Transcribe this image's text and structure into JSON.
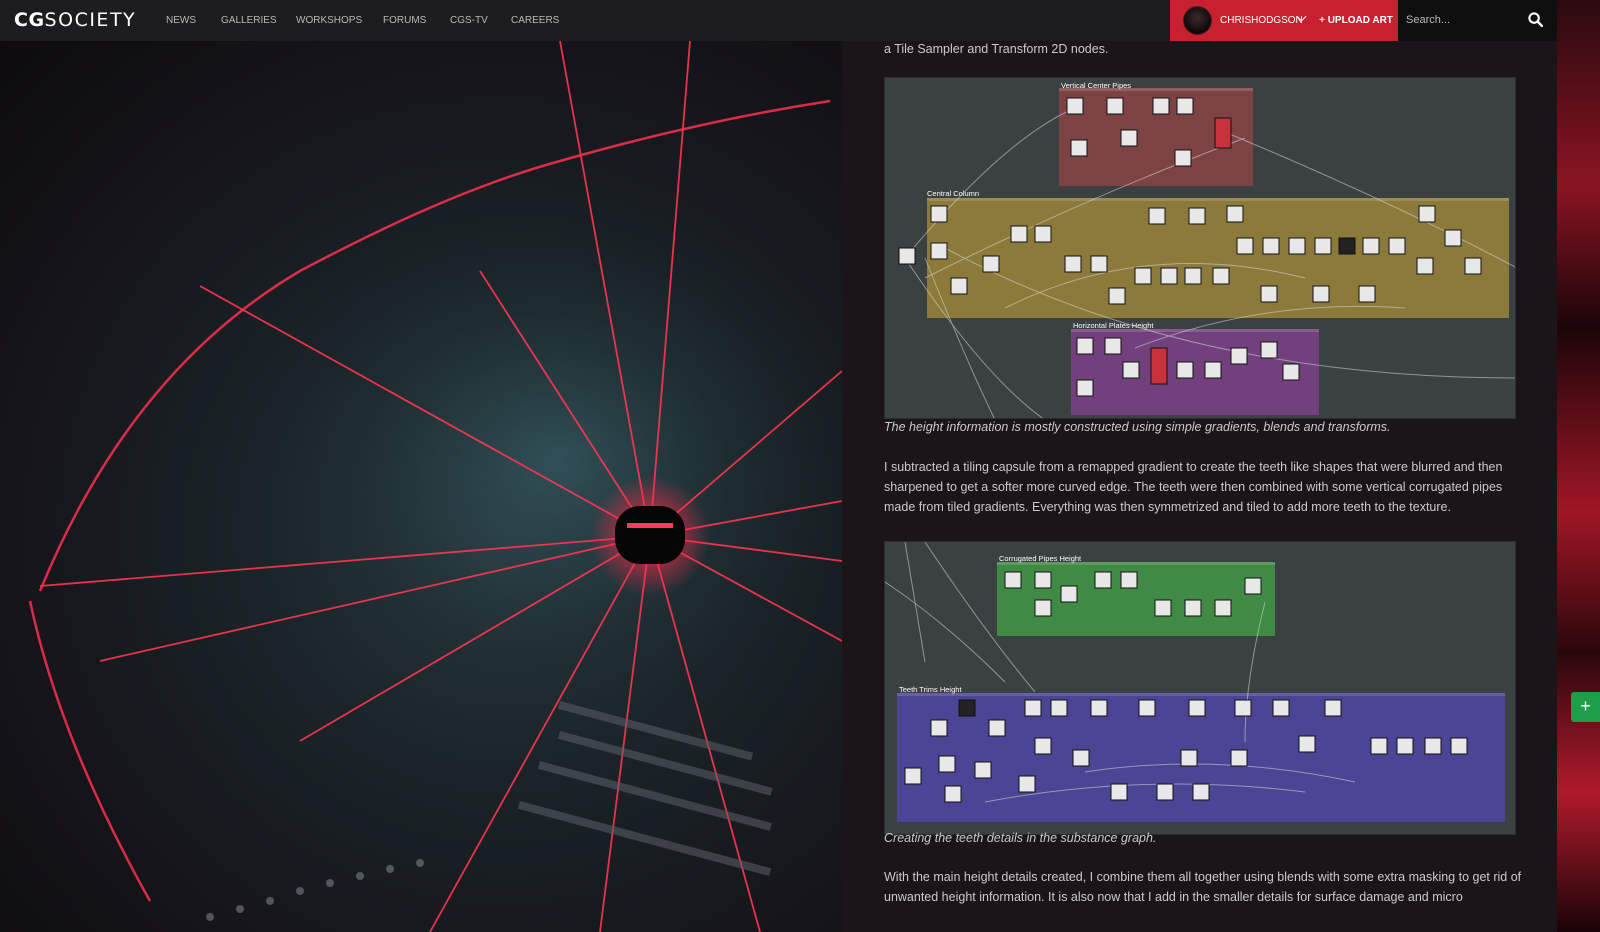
{
  "nav": {
    "logo_bold": "CG",
    "logo_light": "SOCIETY",
    "items": [
      "NEWS",
      "GALLERIES",
      "WORKSHOPS",
      "FORUMS",
      "CGS-TV",
      "CAREERS"
    ]
  },
  "user": {
    "name": "CHRISHODGSON",
    "upload_label": "+ UPLOAD ART"
  },
  "search": {
    "placeholder": "Search..."
  },
  "article": {
    "intro_fragment": "a Tile Sampler and Transform 2D nodes.",
    "graph1": {
      "groups": [
        "Vertical Center Pipes",
        "Central Column",
        "Horizontal Plates Height"
      ]
    },
    "caption1": "The height information is mostly constructed using simple gradients, blends and transforms.",
    "para2": "I subtracted a tiling capsule from a remapped gradient to create the teeth like shapes that were blurred and then sharpened to get a softer more curved edge. The teeth were then combined with some vertical corrugated pipes made from tiled gradients. Everything was then symmetrized and tiled to add more teeth to the texture.",
    "graph2": {
      "groups": [
        "Corrugated Pipes Height",
        "Teeth Trims Height"
      ]
    },
    "caption2": "Creating the teeth details in the substance graph.",
    "para3": "With the main height details created, I combine them all together using blends with some extra masking to get rid of unwanted height information. It is also now that I add in the smaller details for surface damage and micro"
  },
  "fab": {
    "label": "+"
  },
  "colors": {
    "brand_red": "#c7202e",
    "topbar": "#1d1d1f",
    "fab_green": "#1f9e4a"
  }
}
